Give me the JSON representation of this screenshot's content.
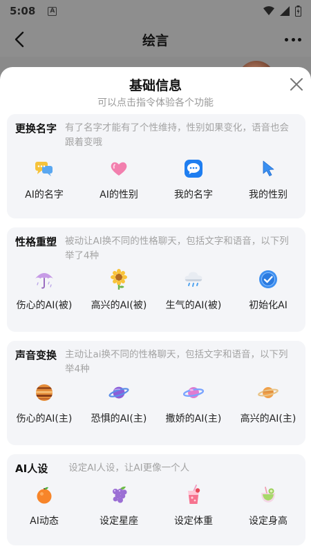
{
  "status": {
    "time": "5:08",
    "indicator": "A"
  },
  "header": {
    "title": "绘言"
  },
  "sheet": {
    "title": "基础信息",
    "subtitle": "可以点击指令体验各个功能"
  },
  "sections": [
    {
      "name": "更换名字",
      "desc": "有了名字才能有了个性维持，性别如果变化，语音也会跟着变哦",
      "items": [
        {
          "label": "AI的名字",
          "icon": "chat-bubbles-icon"
        },
        {
          "label": "AI的性别",
          "icon": "heart-icon"
        },
        {
          "label": "我的名字",
          "icon": "message-icon"
        },
        {
          "label": "我的性别",
          "icon": "cursor-icon"
        }
      ]
    },
    {
      "name": "性格重塑",
      "desc": "被动让AI换不同的性格聊天，包括文字和语音，以下列举了4种",
      "items": [
        {
          "label": "伤心的AI(被)",
          "icon": "umbrella-icon"
        },
        {
          "label": "高兴的AI(被)",
          "icon": "sunflower-icon"
        },
        {
          "label": "生气的AI(被)",
          "icon": "storm-cloud-icon"
        },
        {
          "label": "初始化AI",
          "icon": "check-badge-icon"
        }
      ]
    },
    {
      "name": "声音变换",
      "desc": "主动让ai换不同的性格聊天，包括文字和语音，以下列举4种",
      "items": [
        {
          "label": "伤心的AI(主)",
          "icon": "planet-jupiter-icon"
        },
        {
          "label": "恐惧的AI(主)",
          "icon": "planet-purple-icon"
        },
        {
          "label": "撒娇的AI(主)",
          "icon": "planet-pink-icon"
        },
        {
          "label": "高兴的AI(主)",
          "icon": "planet-saturn-icon"
        }
      ]
    },
    {
      "name": "AI人设",
      "desc": "设定AI人设，让AI更像一个人",
      "items": [
        {
          "label": "AI动态",
          "icon": "orange-icon"
        },
        {
          "label": "设定星座",
          "icon": "grapes-icon"
        },
        {
          "label": "设定体重",
          "icon": "drink-icon"
        },
        {
          "label": "设定身高",
          "icon": "fruit-cup-icon"
        }
      ]
    }
  ]
}
